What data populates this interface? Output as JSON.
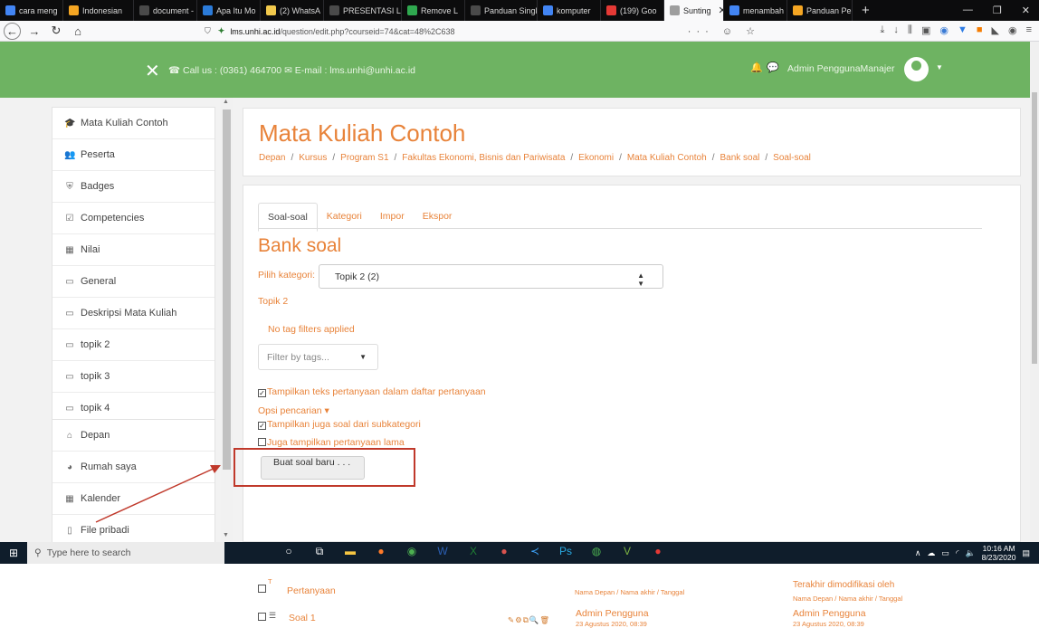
{
  "browser": {
    "tabs": [
      {
        "label": "cara meng",
        "color": "#4285f4",
        "active": false
      },
      {
        "label": "Indonesian",
        "color": "#f5a623",
        "active": false
      },
      {
        "label": "document - mc",
        "color": "#4a4a4a",
        "active": false
      },
      {
        "label": "Apa Itu Mo",
        "color": "#2b7bd9",
        "active": false
      },
      {
        "label": "(2) WhatsA",
        "color": "#f2c94c",
        "active": false
      },
      {
        "label": "PRESENTASI LM",
        "color": "#4a4a4a",
        "active": false
      },
      {
        "label": "Remove L",
        "color": "#2fa84f",
        "active": false
      },
      {
        "label": "Panduan Singk",
        "color": "#4a4a4a",
        "active": false
      },
      {
        "label": "komputer",
        "color": "#4285f4",
        "active": false
      },
      {
        "label": "(199) Goo",
        "color": "#e53935",
        "active": false
      },
      {
        "label": "Sunting",
        "color": "#9e9e9e",
        "active": true
      },
      {
        "label": "menambah",
        "color": "#4285f4",
        "active": false
      },
      {
        "label": "Panduan Pe",
        "color": "#f5a623",
        "active": false
      }
    ],
    "new_tab": "+",
    "window_controls": [
      "—",
      "❐",
      "✕"
    ],
    "url_host": "lms.unhi.ac.id",
    "url_path": "/question/edit.php?courseid=74&cat=48%2C638",
    "url_actions": "··· ☺ ☆"
  },
  "header": {
    "contact": "☎ Call us : (0361) 464700 ✉ E-mail : lms.unhi@unhi.ac.id",
    "user_name": "Admin PenggunaManajer"
  },
  "sidebar": {
    "course_items": [
      {
        "label": "Mata Kuliah Contoh",
        "icon": "graduation-cap-icon",
        "glyph": "🎓"
      },
      {
        "label": "Peserta",
        "icon": "users-icon",
        "glyph": "👥"
      },
      {
        "label": "Badges",
        "icon": "shield-icon",
        "glyph": "⛨"
      },
      {
        "label": "Competencies",
        "icon": "checkbox-icon",
        "glyph": "☑"
      },
      {
        "label": "Nilai",
        "icon": "table-icon",
        "glyph": "▦"
      },
      {
        "label": "General",
        "icon": "folder-icon",
        "glyph": "▭"
      },
      {
        "label": "Deskripsi Mata Kuliah",
        "icon": "folder-icon",
        "glyph": "▭"
      },
      {
        "label": "topik 2",
        "icon": "folder-icon",
        "glyph": "▭"
      },
      {
        "label": "topik 3",
        "icon": "folder-icon",
        "glyph": "▭"
      },
      {
        "label": "topik 4",
        "icon": "folder-icon",
        "glyph": "▭"
      }
    ],
    "site_items": [
      {
        "label": "Depan",
        "icon": "home-icon",
        "glyph": "⌂"
      },
      {
        "label": "Rumah saya",
        "icon": "dashboard-icon",
        "glyph": "◕"
      },
      {
        "label": "Kalender",
        "icon": "calendar-icon",
        "glyph": "▦"
      },
      {
        "label": "File pribadi",
        "icon": "file-icon",
        "glyph": "▯"
      }
    ]
  },
  "main": {
    "title": "Mata Kuliah Contoh",
    "breadcrumb": [
      "Depan",
      "Kursus",
      "Program S1",
      "Fakultas Ekonomi, Bisnis dan Pariwisata",
      "Ekonomi",
      "Mata Kuliah Contoh",
      "Bank soal",
      "Soal-soal"
    ],
    "tabs": [
      "Soal-soal",
      "Kategori",
      "Impor",
      "Ekspor"
    ],
    "bank_title": "Bank soal",
    "category_label": "Pilih kategori:",
    "category_value": "Topik 2 (2)",
    "category_name": "Topik 2",
    "no_tag_filters": "No tag filters applied",
    "tag_placeholder": "Filter by tags...",
    "show_question_text": "Tampilkan teks pertanyaan dalam daftar pertanyaan",
    "search_options": "Opsi pencarian ▾",
    "show_subcategories": "Tampilkan juga soal dari subkategori",
    "show_old": "Juga tampilkan pertanyaan lama",
    "new_question_button": "Buat soal baru . . .",
    "table": {
      "col_question": "Pertanyaan",
      "col_created": "Nama Depan / Nama akhir / Tanggal",
      "col_modified": "Terakhir dimodifikasi oleh",
      "col_modified_sub": "Nama Depan / Nama akhir / Tanggal",
      "rows": [
        {
          "name": "Soal 1",
          "created_by": "Admin Pengguna",
          "created_date": "23 Agustus 2020, 08:39",
          "modified_by": "Admin Pengguna",
          "modified_date": "23 Agustus 2020, 08:39"
        }
      ]
    }
  },
  "taskbar": {
    "search_placeholder": "Type here to search",
    "time": "10:16 AM",
    "date": "8/23/2020"
  },
  "colors": {
    "accent": "#e8833a",
    "header_green": "#6eb362",
    "highlight_red": "#c0392b"
  }
}
